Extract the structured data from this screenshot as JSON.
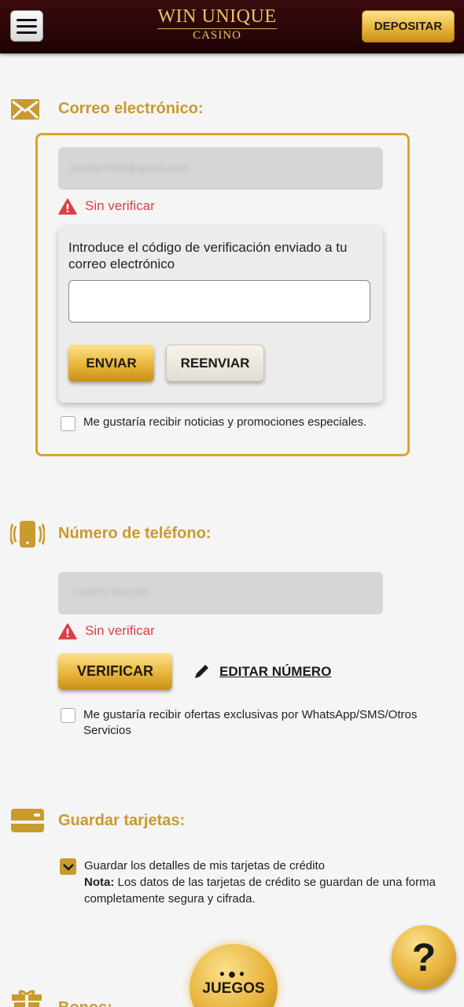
{
  "header": {
    "logo_main": "WIN UNIQUE",
    "logo_sub": "CASINO",
    "deposit_label": "DEPOSITAR"
  },
  "email": {
    "title": "Correo electrónico:",
    "value": "jackbe7890@gmail.com",
    "status": "Sin verificar",
    "verify_prompt": "Introduce el código de verificación enviado a tu correo electrónico",
    "code_value": "",
    "send_label": "ENVIAR",
    "resend_label": "REENVIAR",
    "newsletter_label": "Me gustaría recibir noticias y promociones especiales."
  },
  "phone": {
    "title": "Número de teléfono:",
    "value": "+34675 950285",
    "status": "Sin verificar",
    "verify_label": "VERIFICAR",
    "edit_label": "EDITAR NÚMERO",
    "offers_label": "Me gustaría recibir ofertas exclusivas por WhatsApp/SMS/Otros Servicios"
  },
  "cards": {
    "title": "Guardar tarjetas:",
    "save_label": "Guardar los detalles de mis tarjetas de crédito",
    "note_bold": "Nota:",
    "note_text": " Los datos de las tarjetas de crédito se guardan de una forma completamente segura y cifrada.",
    "checked": true
  },
  "bonus": {
    "title": "Bonos:"
  },
  "floating": {
    "help_symbol": "?",
    "games_label": "JUEGOS",
    "games_dots": "•●•"
  },
  "colors": {
    "accent_gold": "#c99a2e",
    "box_border": "#d9a62a",
    "status_red": "#d9404a",
    "header_bg": "#2a0508"
  },
  "icons": [
    "menu-icon",
    "envelope-icon",
    "warning-icon",
    "phone-vibrate-icon",
    "pencil-icon",
    "credit-card-icon",
    "checkmark-icon",
    "gift-icon",
    "help-icon"
  ]
}
